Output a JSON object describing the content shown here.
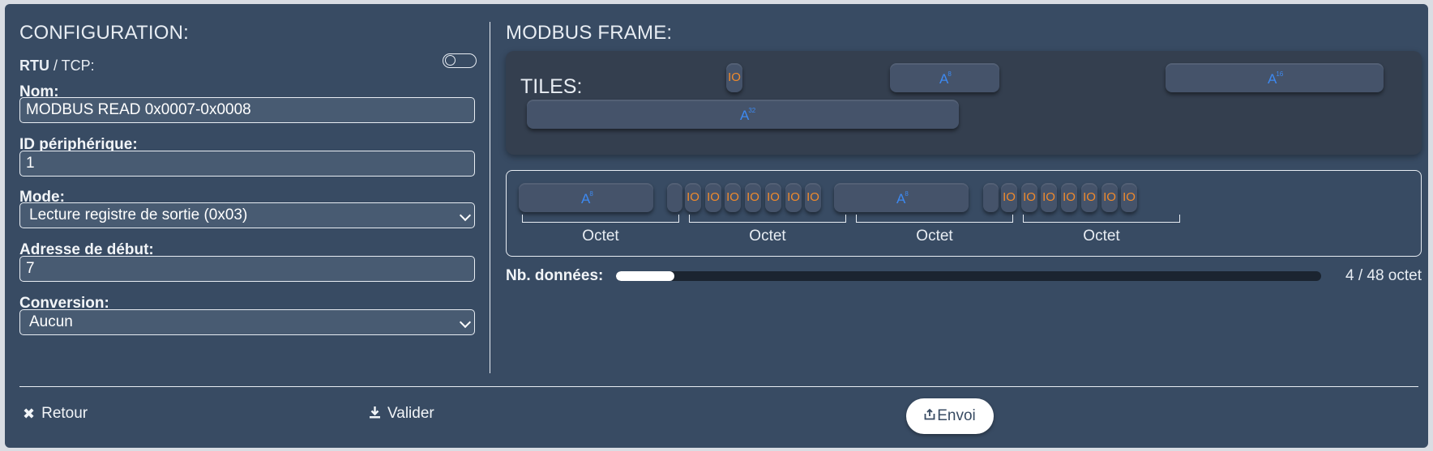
{
  "config": {
    "title": "CONFIGURATION:",
    "rtu_label": "RTU",
    "rtu_sep": " / TCP:",
    "fields": {
      "nom_label": "Nom:",
      "nom_value": "MODBUS READ 0x0007-0x0008",
      "id_label": "ID périphérique:",
      "id_value": "1",
      "mode_label": "Mode:",
      "mode_value": "Lecture registre de sortie (0x03)",
      "adresse_label": "Adresse de début:",
      "adresse_value": "7",
      "conversion_label": "Conversion:",
      "conversion_value": "Aucun"
    }
  },
  "frame": {
    "title": "MODBUS FRAME:",
    "tiles_label": "TILES:",
    "io_text": "IO",
    "a_text": "A",
    "tiles_sup": {
      "a8": "8",
      "a16": "16",
      "a32": "32"
    },
    "octet_label": "Octet",
    "nb_label": "Nb. données:",
    "count_text": "4 / 48 octet",
    "progress_fraction": 0.0833
  },
  "footer": {
    "retour_label": "Retour",
    "valider_label": "Valider",
    "envoi_label": "Envoi",
    "retour_icon": "close-icon",
    "valider_icon": "download-icon",
    "envoi_icon": "upload-icon"
  }
}
